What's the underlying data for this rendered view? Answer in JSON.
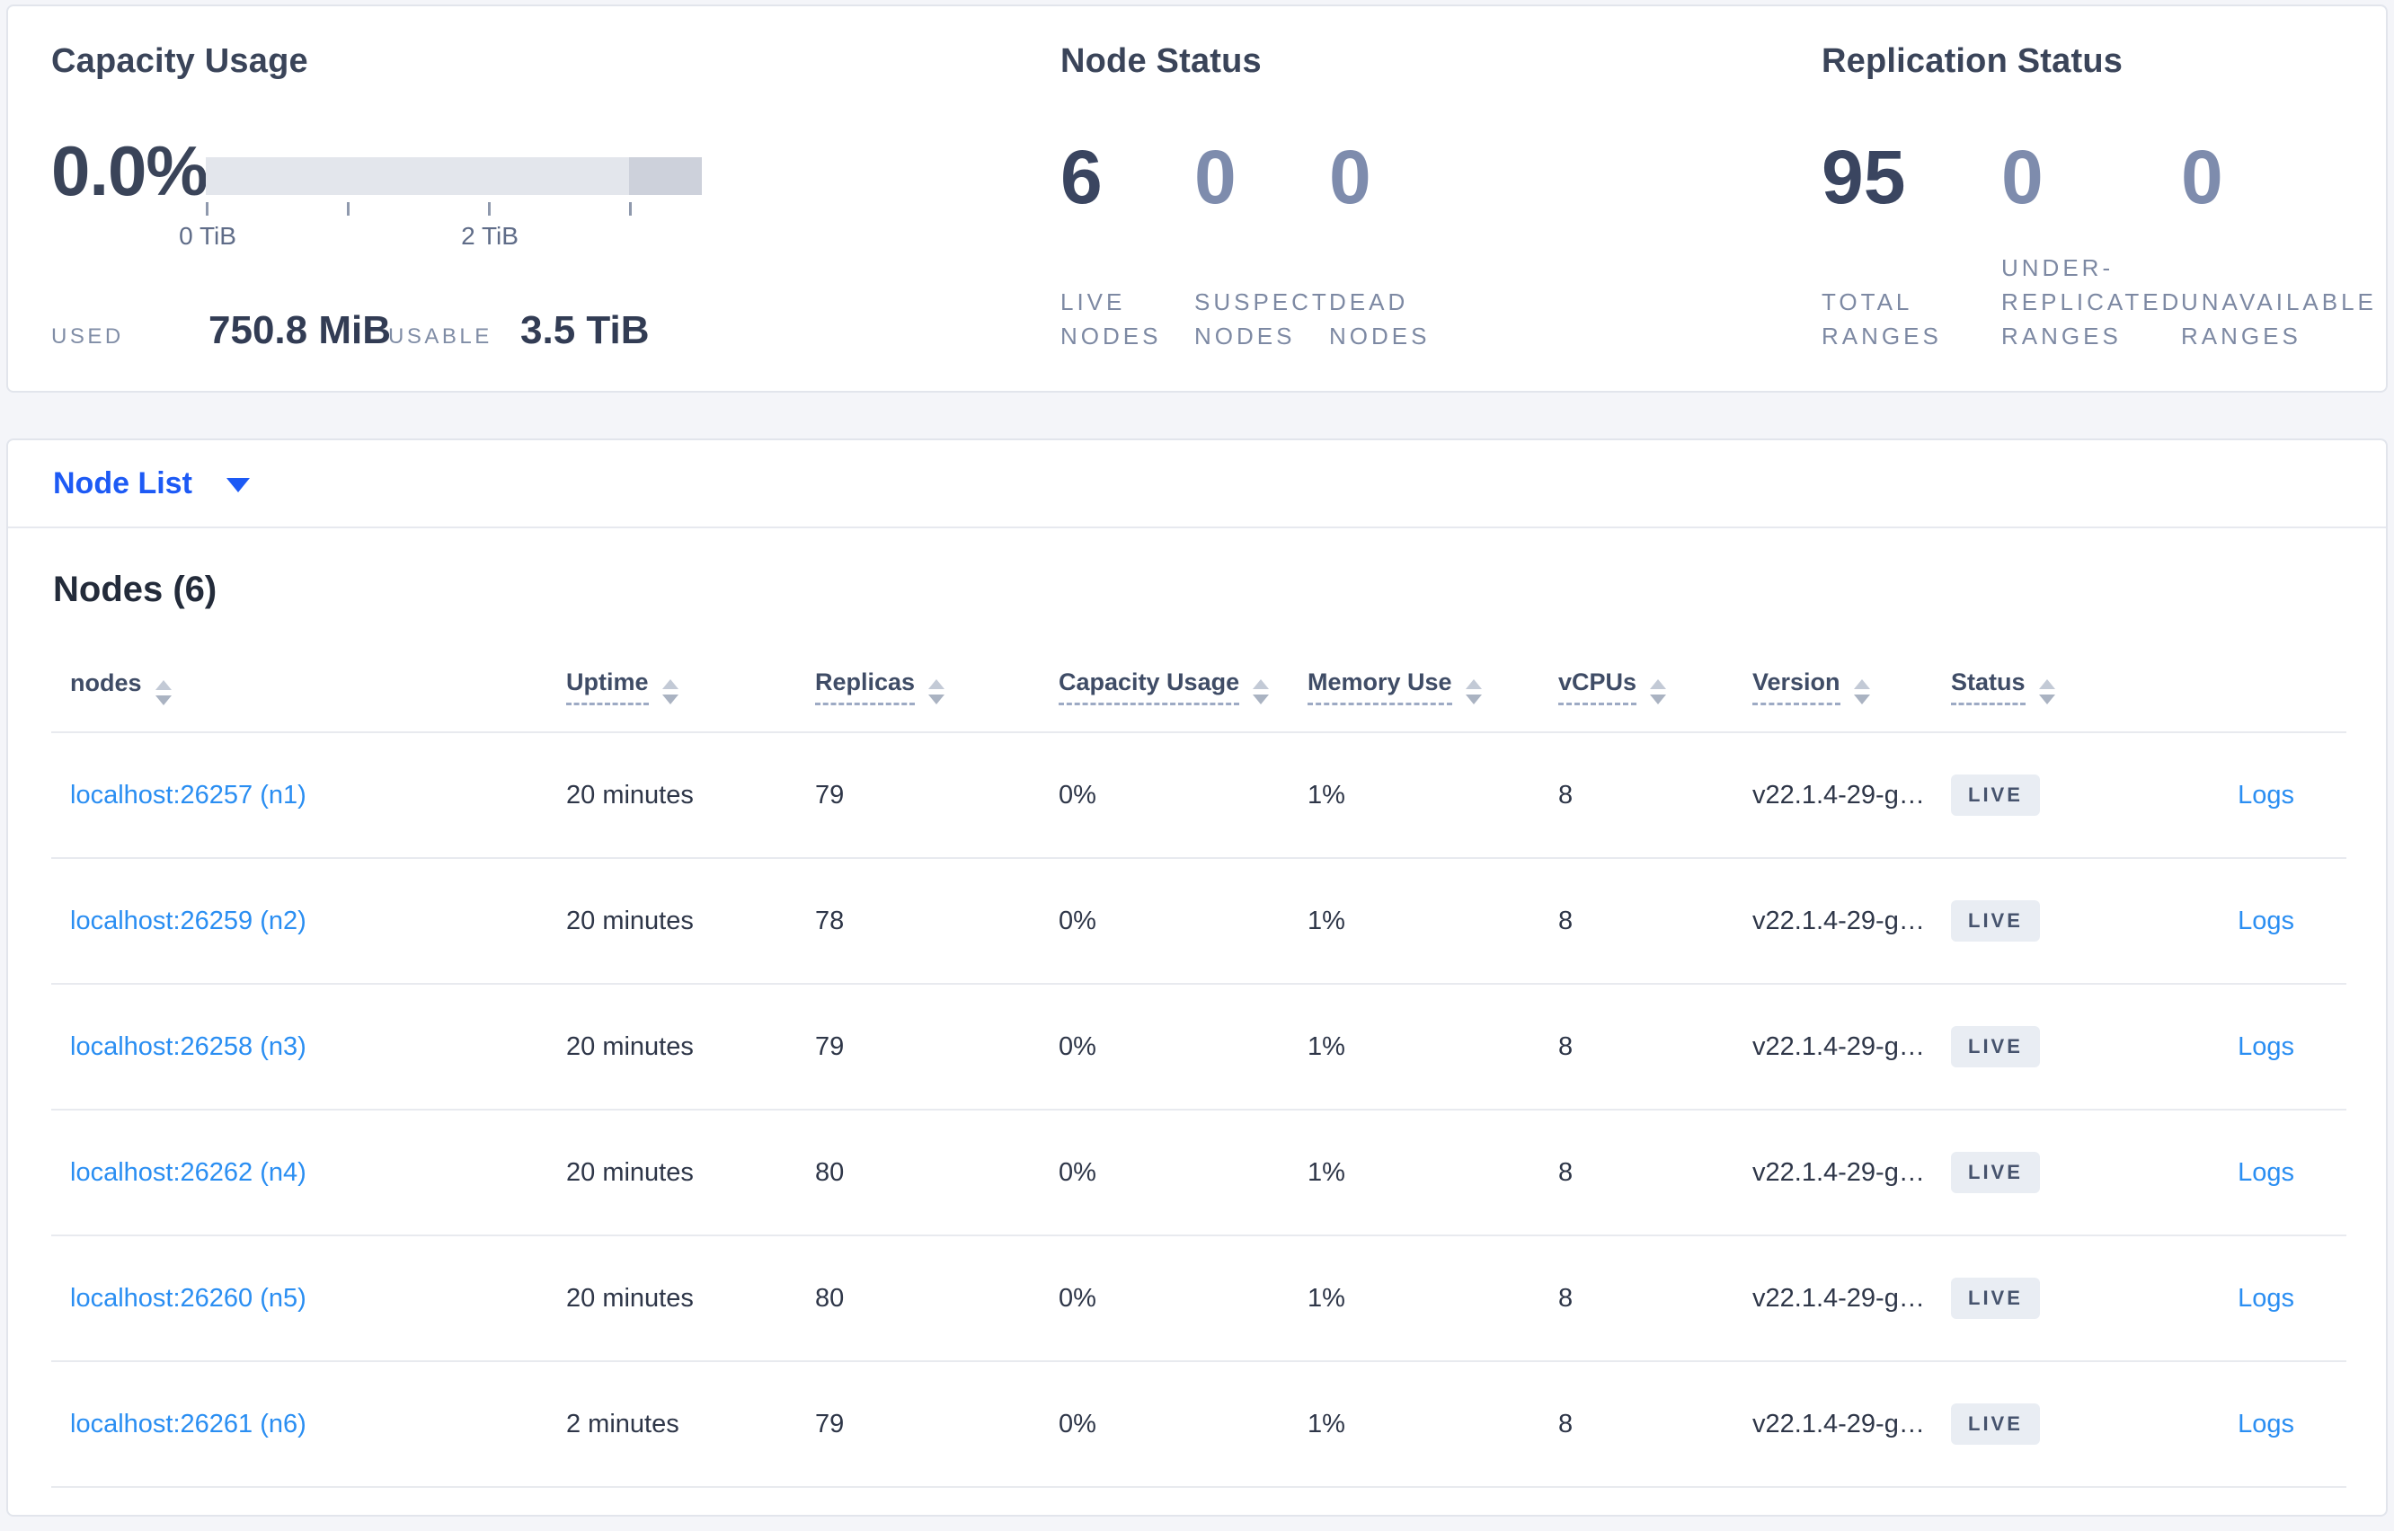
{
  "colors": {
    "page_bg": "#f4f5f9",
    "card_bg": "#ffffff",
    "accent_blue": "#1d5af5",
    "link_blue": "#2a8ef2",
    "dark_text": "#3a4459",
    "muted_stat_number": "#7e8cad",
    "muted_label": "#7d89a3",
    "divider": "#e8eaef",
    "badge_bg": "#e9edf3",
    "badge_text": "#46536d",
    "bar_light": "#e3e6ec",
    "bar_dark": "#cdd1db"
  },
  "summary": {
    "capacity": {
      "title": "Capacity Usage",
      "percent": "0.0%",
      "axis_label_0": "0 TiB",
      "axis_label_2": "2 TiB",
      "used_label": "USED",
      "used_value": "750.8 MiB",
      "usable_label": "USABLE",
      "usable_value": "3.5 TiB"
    },
    "node_status": {
      "title": "Node Status",
      "stats": [
        {
          "value": "6",
          "label": "LIVE\nNODES"
        },
        {
          "value": "0",
          "label": "SUSPECT\nNODES"
        },
        {
          "value": "0",
          "label": "DEAD\nNODES"
        }
      ]
    },
    "replication": {
      "title": "Replication Status",
      "stats": [
        {
          "value": "95",
          "label": "TOTAL\nRANGES"
        },
        {
          "value": "0",
          "label": "UNDER-\nREPLICATED\nRANGES"
        },
        {
          "value": "0",
          "label": "UNAVAILABLE\nRANGES"
        }
      ]
    }
  },
  "nodelist": {
    "dropdown_label": "Node List",
    "heading": "Nodes (6)"
  },
  "table": {
    "columns": [
      {
        "label": "nodes",
        "underline": false,
        "sortable": true
      },
      {
        "label": "Uptime",
        "underline": true,
        "sortable": true
      },
      {
        "label": "Replicas",
        "underline": true,
        "sortable": true
      },
      {
        "label": "Capacity Usage",
        "underline": true,
        "sortable": true
      },
      {
        "label": "Memory Use",
        "underline": true,
        "sortable": true
      },
      {
        "label": "vCPUs",
        "underline": true,
        "sortable": true
      },
      {
        "label": "Version",
        "underline": true,
        "sortable": true
      },
      {
        "label": "Status",
        "underline": true,
        "sortable": true
      },
      {
        "label": "",
        "underline": false,
        "sortable": false
      }
    ],
    "rows": [
      {
        "node": "localhost:26257 (n1)",
        "uptime": "20 minutes",
        "replicas": "79",
        "capacity": "0%",
        "memory": "1%",
        "vcpus": "8",
        "version": "v22.1.4-29-g…",
        "status": "LIVE",
        "logs": "Logs"
      },
      {
        "node": "localhost:26259 (n2)",
        "uptime": "20 minutes",
        "replicas": "78",
        "capacity": "0%",
        "memory": "1%",
        "vcpus": "8",
        "version": "v22.1.4-29-g…",
        "status": "LIVE",
        "logs": "Logs"
      },
      {
        "node": "localhost:26258 (n3)",
        "uptime": "20 minutes",
        "replicas": "79",
        "capacity": "0%",
        "memory": "1%",
        "vcpus": "8",
        "version": "v22.1.4-29-g…",
        "status": "LIVE",
        "logs": "Logs"
      },
      {
        "node": "localhost:26262 (n4)",
        "uptime": "20 minutes",
        "replicas": "80",
        "capacity": "0%",
        "memory": "1%",
        "vcpus": "8",
        "version": "v22.1.4-29-g…",
        "status": "LIVE",
        "logs": "Logs"
      },
      {
        "node": "localhost:26260 (n5)",
        "uptime": "20 minutes",
        "replicas": "80",
        "capacity": "0%",
        "memory": "1%",
        "vcpus": "8",
        "version": "v22.1.4-29-g…",
        "status": "LIVE",
        "logs": "Logs"
      },
      {
        "node": "localhost:26261 (n6)",
        "uptime": "2 minutes",
        "replicas": "79",
        "capacity": "0%",
        "memory": "1%",
        "vcpus": "8",
        "version": "v22.1.4-29-g…",
        "status": "LIVE",
        "logs": "Logs"
      }
    ]
  }
}
